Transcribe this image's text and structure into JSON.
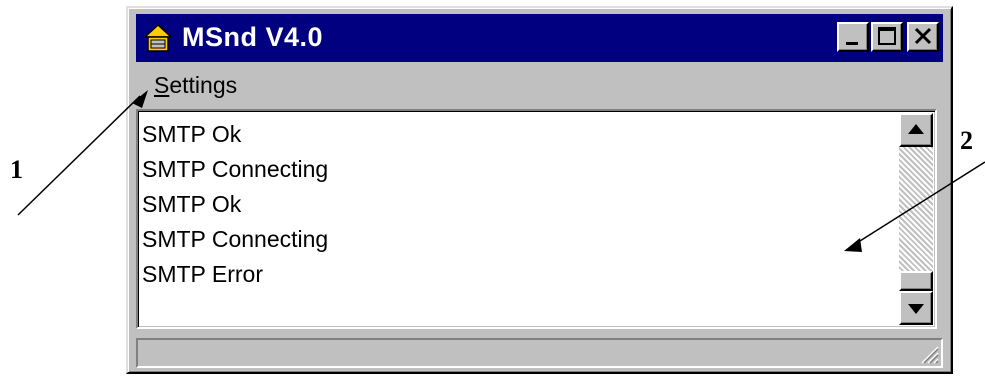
{
  "window": {
    "title": "MSnd V4.0",
    "icon": "house-icon"
  },
  "titlebar_buttons": {
    "minimize_icon": "minimize-icon",
    "maximize_icon": "maximize-icon",
    "close_icon": "close-icon"
  },
  "menu": {
    "settings_accel": "S",
    "settings_rest": "ettings"
  },
  "log": [
    "SMTP Ok",
    "SMTP Connecting",
    "SMTP Ok",
    "SMTP Connecting",
    "SMTP Error"
  ],
  "callouts": {
    "one": "1",
    "two": "2"
  },
  "colors": {
    "title_bar": "#000080",
    "face": "#c0c0c0",
    "list_bg": "#ffffff"
  }
}
